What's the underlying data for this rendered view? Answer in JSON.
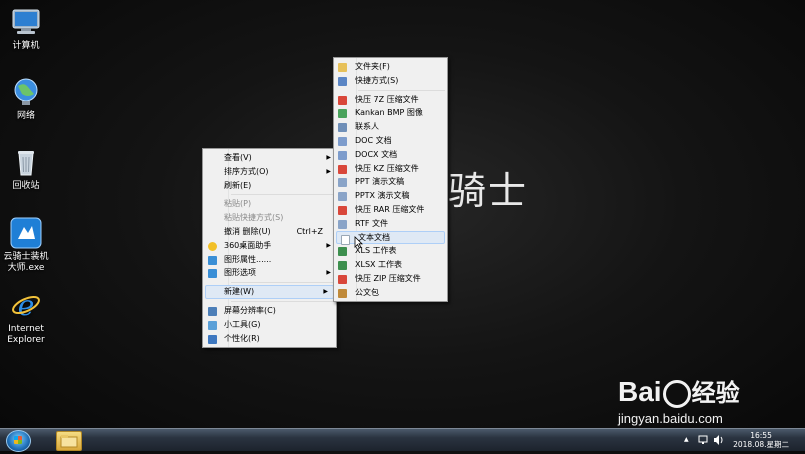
{
  "desktop": {
    "wallpaper_text": "骑士",
    "icons": [
      {
        "label": "计算机",
        "icon": "computer-icon"
      },
      {
        "label": "网络",
        "icon": "network-icon"
      },
      {
        "label": "回收站",
        "icon": "recycle-bin-icon"
      },
      {
        "label": "云骑士装机大师.exe",
        "icon": "app-knight-icon"
      },
      {
        "label": "Internet Explorer",
        "icon": "ie-icon"
      }
    ]
  },
  "context_menu": {
    "items": [
      {
        "label": "查看(V)",
        "arrow": "▶"
      },
      {
        "label": "排序方式(O)",
        "arrow": "▶"
      },
      {
        "label": "刷新(E)"
      },
      {
        "label": "粘贴(P)",
        "disabled": true
      },
      {
        "label": "粘贴快捷方式(S)",
        "disabled": true
      },
      {
        "label": "撤消 删除(U)",
        "shortcut": "Ctrl+Z"
      },
      {
        "label": "360桌面助手",
        "arrow": "▶"
      },
      {
        "label": "图形属性......"
      },
      {
        "label": "图形选项",
        "arrow": "▶"
      },
      {
        "label": "新建(W)",
        "arrow": "▶"
      },
      {
        "label": "屏幕分辨率(C)"
      },
      {
        "label": "小工具(G)"
      },
      {
        "label": "个性化(R)"
      }
    ]
  },
  "new_submenu": {
    "items": [
      {
        "label": "文件夹(F)",
        "color": "#e7c15a"
      },
      {
        "label": "快捷方式(S)",
        "color": "#5b86c5"
      },
      {
        "label": "快压 7Z 压缩文件",
        "color": "#d9473a"
      },
      {
        "label": "Kankan BMP 图像",
        "color": "#4aa35c"
      },
      {
        "label": "联系人",
        "color": "#6f8fb8"
      },
      {
        "label": "DOC 文档",
        "color": "#7d9ccc"
      },
      {
        "label": "DOCX 文档",
        "color": "#7d9ccc"
      },
      {
        "label": "快压 KZ 压缩文件",
        "color": "#d9473a"
      },
      {
        "label": "PPT 演示文稿",
        "color": "#8aa4c8"
      },
      {
        "label": "PPTX 演示文稿",
        "color": "#8aa4c8"
      },
      {
        "label": "快压 RAR 压缩文件",
        "color": "#d9473a"
      },
      {
        "label": "RTF 文件",
        "color": "#8aa4c8"
      },
      {
        "label": "文本文档",
        "color": "#ffffff"
      },
      {
        "label": "XLS 工作表",
        "color": "#3d8f4e"
      },
      {
        "label": "XLSX 工作表",
        "color": "#3d8f4e"
      },
      {
        "label": "快压 ZIP 压缩文件",
        "color": "#d9473a"
      },
      {
        "label": "公文包",
        "color": "#c08a3a"
      }
    ]
  },
  "taskbar": {
    "time": "16:55",
    "date": "2018.08.星期二",
    "tray_arrow": "▲"
  },
  "watermark": {
    "logo_text": "Bai",
    "logo_suffix": "经验",
    "url": "jingyan.baidu.com"
  }
}
